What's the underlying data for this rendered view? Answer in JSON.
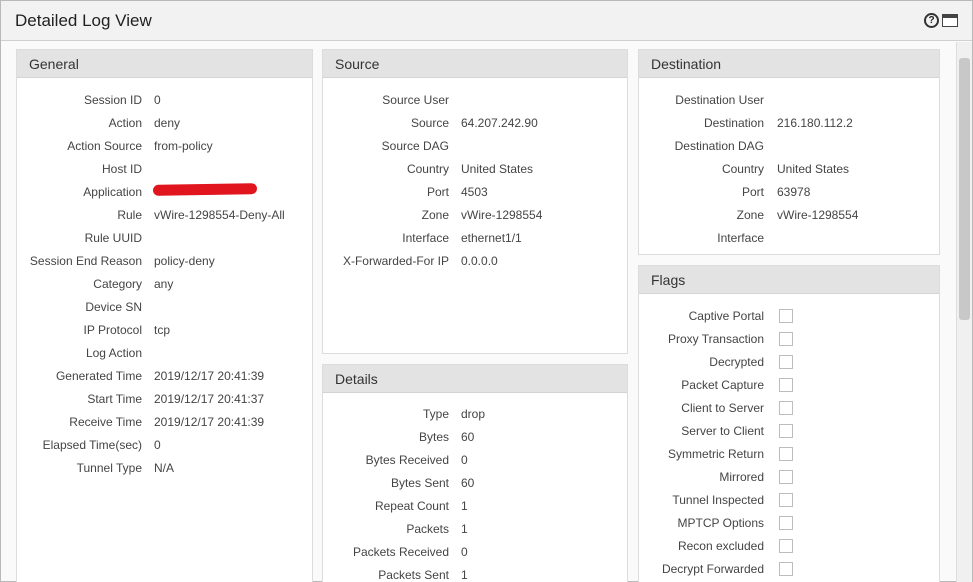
{
  "window": {
    "title": "Detailed Log View"
  },
  "general": {
    "header": "General",
    "rows": [
      {
        "label": "Session ID",
        "value": "0"
      },
      {
        "label": "Action",
        "value": "deny"
      },
      {
        "label": "Action Source",
        "value": "from-policy"
      },
      {
        "label": "Host ID",
        "value": ""
      },
      {
        "label": "Application",
        "value": ""
      },
      {
        "label": "Rule",
        "value": "vWire-1298554-Deny-All"
      },
      {
        "label": "Rule UUID",
        "value": ""
      },
      {
        "label": "Session End Reason",
        "value": "policy-deny"
      },
      {
        "label": "Category",
        "value": "any"
      },
      {
        "label": "Device SN",
        "value": ""
      },
      {
        "label": "IP Protocol",
        "value": "tcp"
      },
      {
        "label": "Log Action",
        "value": ""
      },
      {
        "label": "Generated Time",
        "value": "2019/12/17 20:41:39"
      },
      {
        "label": "Start Time",
        "value": "2019/12/17 20:41:37"
      },
      {
        "label": "Receive Time",
        "value": "2019/12/17 20:41:39"
      },
      {
        "label": "Elapsed Time(sec)",
        "value": "0"
      },
      {
        "label": "Tunnel Type",
        "value": "N/A"
      }
    ]
  },
  "source": {
    "header": "Source",
    "rows": [
      {
        "label": "Source User",
        "value": ""
      },
      {
        "label": "Source",
        "value": "64.207.242.90"
      },
      {
        "label": "Source DAG",
        "value": ""
      },
      {
        "label": "Country",
        "value": "United States"
      },
      {
        "label": "Port",
        "value": "4503"
      },
      {
        "label": "Zone",
        "value": "vWire-1298554"
      },
      {
        "label": "Interface",
        "value": "ethernet1/1"
      },
      {
        "label": "X-Forwarded-For IP",
        "value": "0.0.0.0"
      }
    ]
  },
  "destination": {
    "header": "Destination",
    "rows": [
      {
        "label": "Destination User",
        "value": ""
      },
      {
        "label": "Destination",
        "value": "216.180.112.2"
      },
      {
        "label": "Destination DAG",
        "value": ""
      },
      {
        "label": "Country",
        "value": "United States"
      },
      {
        "label": "Port",
        "value": "63978"
      },
      {
        "label": "Zone",
        "value": "vWire-1298554"
      },
      {
        "label": "Interface",
        "value": ""
      }
    ]
  },
  "details": {
    "header": "Details",
    "rows": [
      {
        "label": "Type",
        "value": "drop"
      },
      {
        "label": "Bytes",
        "value": "60"
      },
      {
        "label": "Bytes Received",
        "value": "0"
      },
      {
        "label": "Bytes Sent",
        "value": "60"
      },
      {
        "label": "Repeat Count",
        "value": "1"
      },
      {
        "label": "Packets",
        "value": "1"
      },
      {
        "label": "Packets Received",
        "value": "0"
      },
      {
        "label": "Packets Sent",
        "value": "1"
      }
    ]
  },
  "flags": {
    "header": "Flags",
    "rows": [
      {
        "label": "Captive Portal",
        "checked": false
      },
      {
        "label": "Proxy Transaction",
        "checked": false
      },
      {
        "label": "Decrypted",
        "checked": false
      },
      {
        "label": "Packet Capture",
        "checked": false
      },
      {
        "label": "Client to Server",
        "checked": false
      },
      {
        "label": "Server to Client",
        "checked": false
      },
      {
        "label": "Symmetric Return",
        "checked": false
      },
      {
        "label": "Mirrored",
        "checked": false
      },
      {
        "label": "Tunnel Inspected",
        "checked": false
      },
      {
        "label": "MPTCP Options",
        "checked": false
      },
      {
        "label": "Recon excluded",
        "checked": false
      },
      {
        "label": "Decrypt Forwarded",
        "checked": false
      }
    ]
  }
}
